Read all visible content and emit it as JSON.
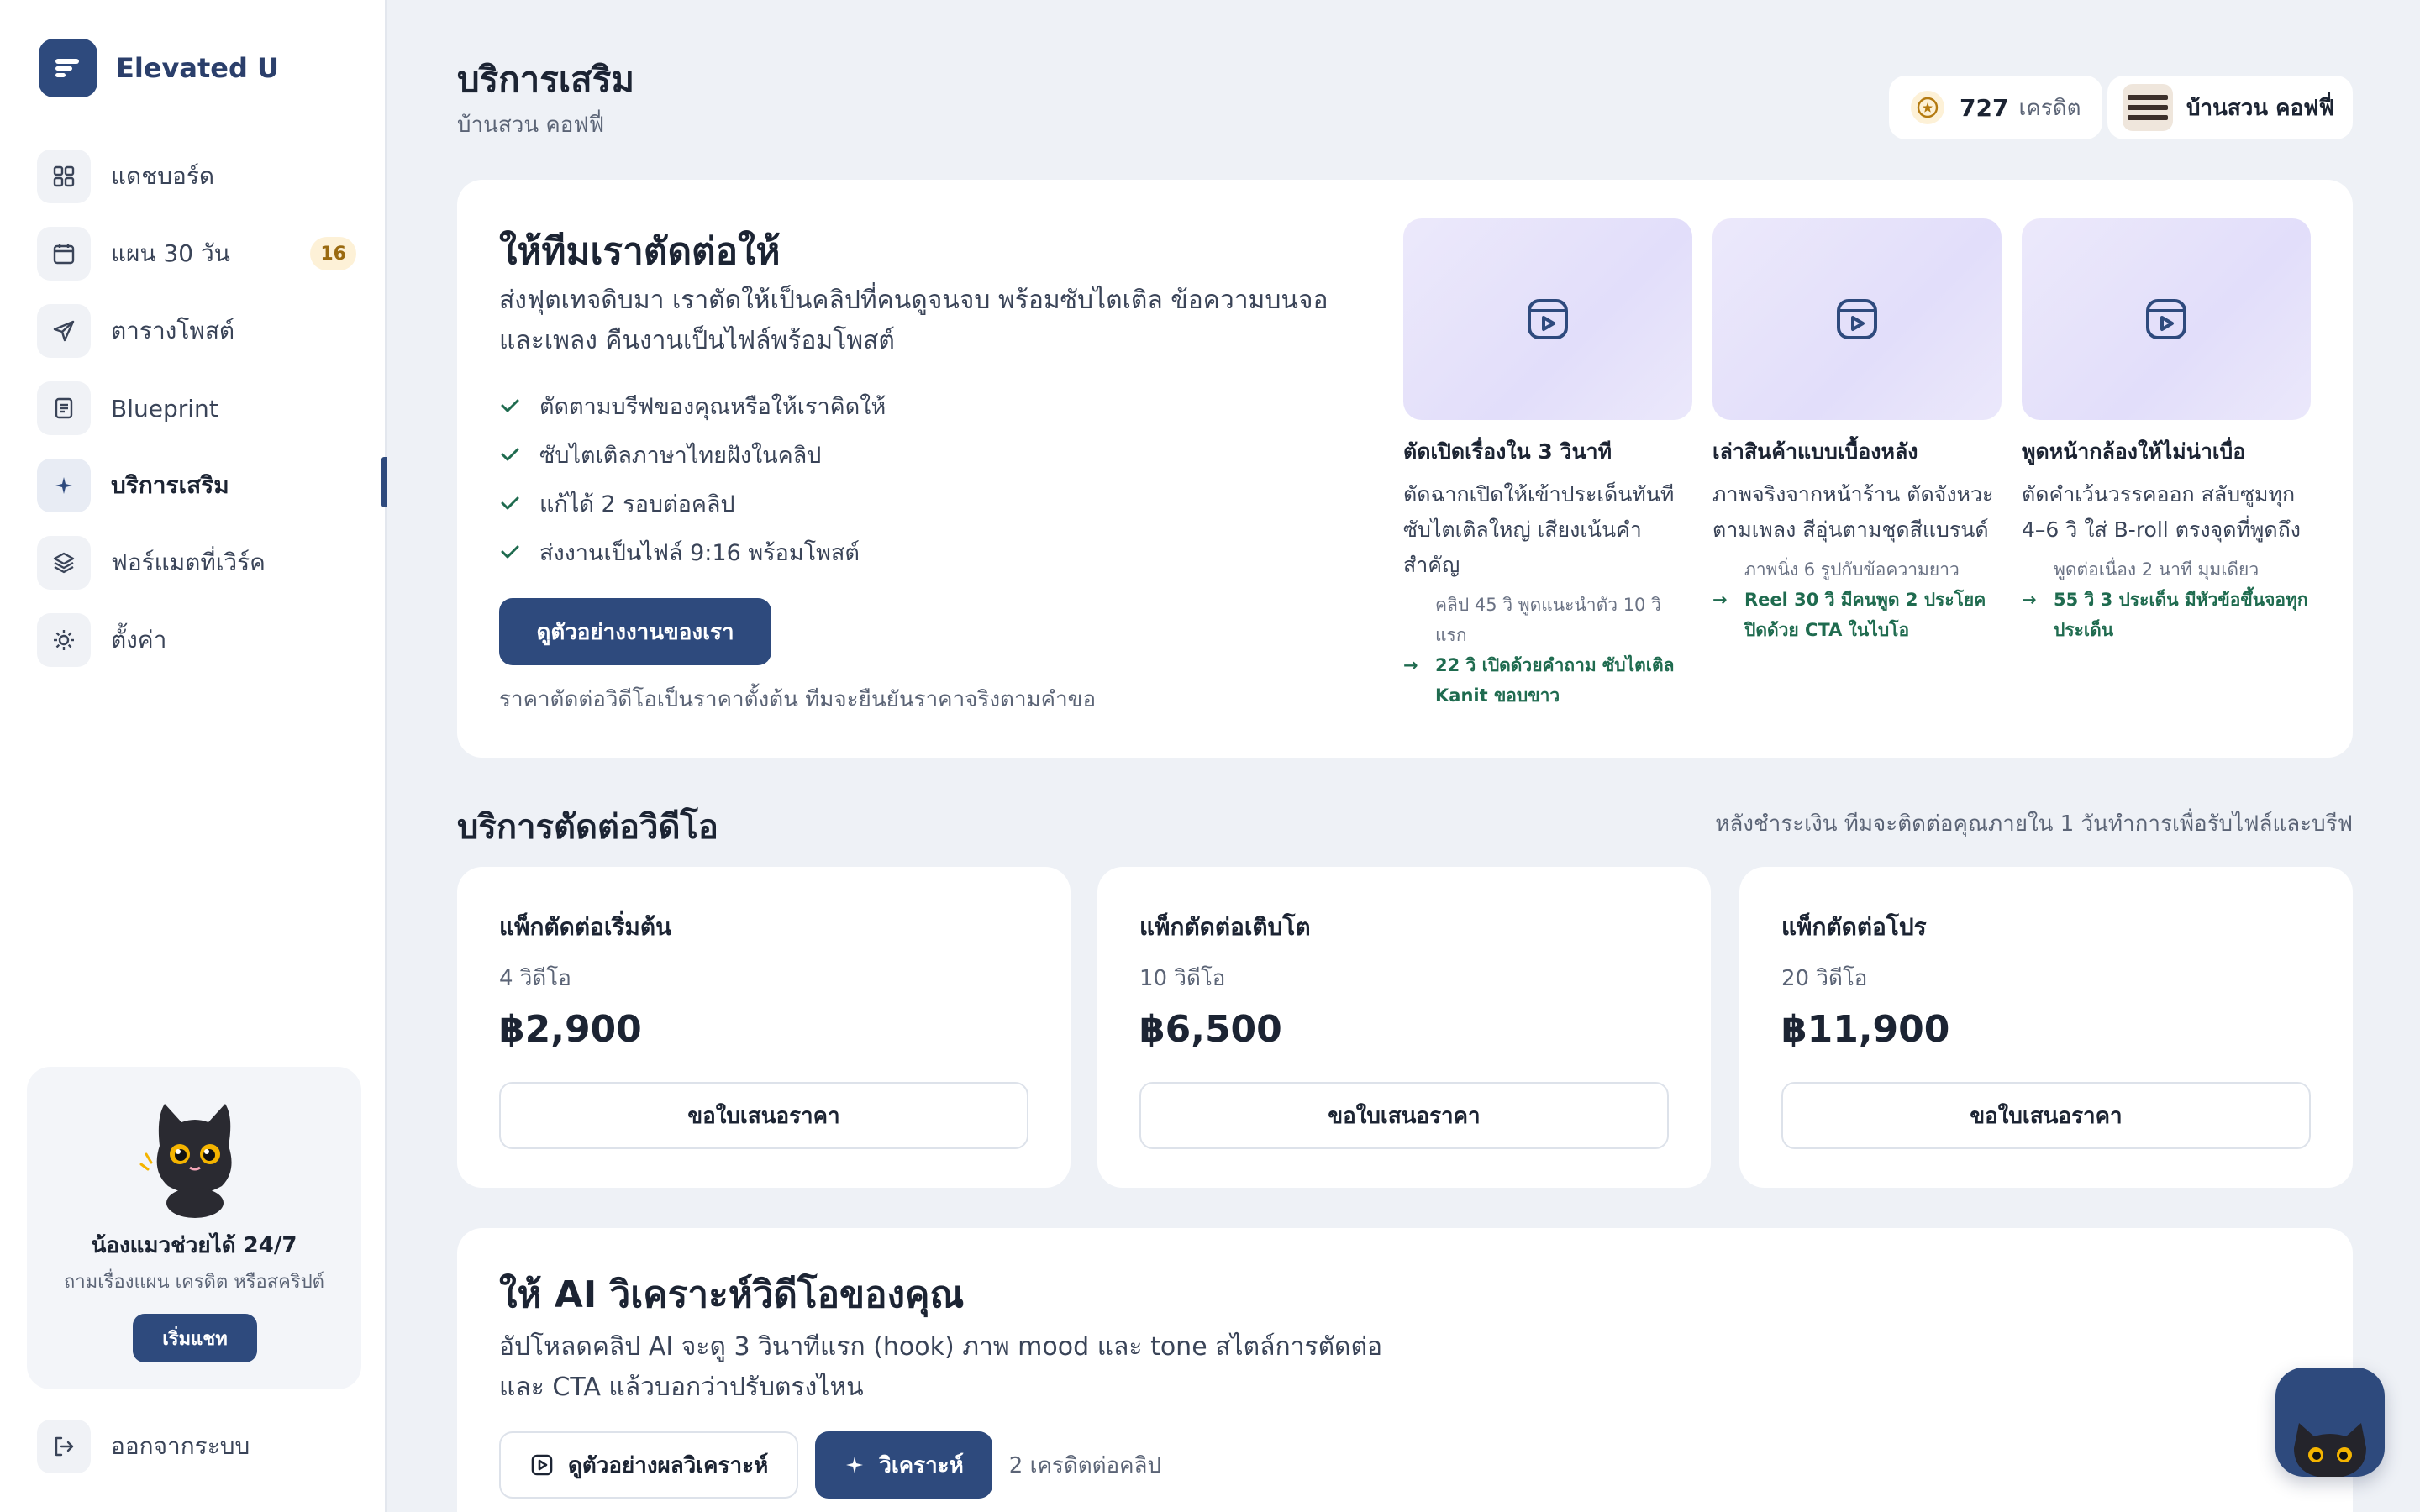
{
  "brand": {
    "name": "Elevated U"
  },
  "sidebar": {
    "items": [
      {
        "label": "แดชบอร์ด",
        "icon": "grid-icon"
      },
      {
        "label": "แผน 30 วัน",
        "icon": "calendar-icon",
        "badge": "16"
      },
      {
        "label": "ตารางโพสต์",
        "icon": "send-icon"
      },
      {
        "label": "Blueprint",
        "icon": "document-icon"
      },
      {
        "label": "บริการเสริม",
        "icon": "sparkle-icon",
        "active": true
      },
      {
        "label": "ฟอร์แมตที่เวิร์ค",
        "icon": "layers-icon"
      },
      {
        "label": "ตั้งค่า",
        "icon": "gear-icon"
      }
    ],
    "help": {
      "title": "น้องแมวช่วยได้ 24/7",
      "subtitle": "ถามเรื่องแผน เครดิต หรือสคริปต์",
      "button": "เริ่มแชท"
    },
    "logout": "ออกจากระบบ"
  },
  "header": {
    "title": "บริการเสริม",
    "subtitle": "บ้านสวน คอฟฟี่",
    "credits": {
      "value": "727",
      "unit": "เครดิต"
    },
    "shop": "บ้านสวน คอฟฟี่"
  },
  "hero": {
    "title": "ให้ทีมเราตัดต่อให้",
    "description": "ส่งฟุตเทจดิบมา เราตัดให้เป็นคลิปที่คนดูจนจบ พร้อมซับไตเติล ข้อความบนจอ และเพลง คืนงานเป็นไฟล์พร้อมโพสต์",
    "checks": [
      "ตัดตามบรีฟของคุณหรือให้เราคิดให้",
      "ซับไตเติลภาษาไทยฝังในคลิป",
      "แก้ได้ 2 รอบต่อคลิป",
      "ส่งงานเป็นไฟล์ 9:16 พร้อมโพสต์"
    ],
    "button": "ดูตัวอย่างงานของเรา",
    "note": "ราคาตัดต่อวิดีโอเป็นราคาตั้งต้น ทีมจะยืนยันราคาจริงตามคำขอ",
    "samples": [
      {
        "title": "ตัดเปิดเรื่องใน 3 วินาที",
        "description": "ตัดฉากเปิดให้เข้าประเด็นทันที ซับไตเติลใหญ่ เสียงเน้นคำสำคัญ",
        "meta": "คลิป 45 วิ พูดแนะนำตัว 10 วิแรก",
        "result": "22 วิ เปิดด้วยคำถาม ซับไตเติล Kanit ขอบขาว"
      },
      {
        "title": "เล่าสินค้าแบบเบื้องหลัง",
        "description": "ภาพจริงจากหน้าร้าน ตัดจังหวะตามเพลง สีอุ่นตามชุดสีแบรนด์",
        "meta": "ภาพนิ่ง 6 รูปกับข้อความยาว",
        "result": "Reel 30 วิ มีคนพูด 2 ประโยค ปิดด้วย CTA ในไบโอ"
      },
      {
        "title": "พูดหน้ากล้องให้ไม่น่าเบื่อ",
        "description": "ตัดคำเว้นวรรคออก สลับซูมทุก 4–6 วิ ใส่ B-roll ตรงจุดที่พูดถึง",
        "meta": "พูดต่อเนื่อง 2 นาที มุมเดียว",
        "result": "55 วิ 3 ประเด็น มีหัวข้อขึ้นจอทุกประเด็น"
      }
    ]
  },
  "editing": {
    "title": "บริการตัดต่อวิดีโอ",
    "note": "หลังชำระเงิน ทีมจะติดต่อคุณภายใน 1 วันทำการเพื่อรับไฟล์และบรีฟ",
    "packages": [
      {
        "name": "แพ็กตัดต่อเริ่มต้น",
        "count": "4 วิดีโอ",
        "price": "฿2,900",
        "button": "ขอใบเสนอราคา"
      },
      {
        "name": "แพ็กตัดต่อเติบโต",
        "count": "10 วิดีโอ",
        "price": "฿6,500",
        "button": "ขอใบเสนอราคา"
      },
      {
        "name": "แพ็กตัดต่อโปร",
        "count": "20 วิดีโอ",
        "price": "฿11,900",
        "button": "ขอใบเสนอราคา"
      }
    ]
  },
  "ai": {
    "title": "ให้ AI วิเคราะห์วิดีโอของคุณ",
    "description": "อัปโหลดคลิป AI จะดู 3 วินาทีแรก (hook) ภาพ mood และ tone สไตล์การตัดต่อ และ CTA แล้วบอกว่าปรับตรงไหน",
    "example_button": "ดูตัวอย่างผลวิเคราะห์",
    "analyze_button": "วิเคราะห์",
    "cost": "2 เครดิตต่อคลิป"
  },
  "colors": {
    "primary": "#2e4a7d",
    "background": "#eef1f6",
    "success": "#1f6b4f",
    "badge": "#fdf1d7"
  }
}
